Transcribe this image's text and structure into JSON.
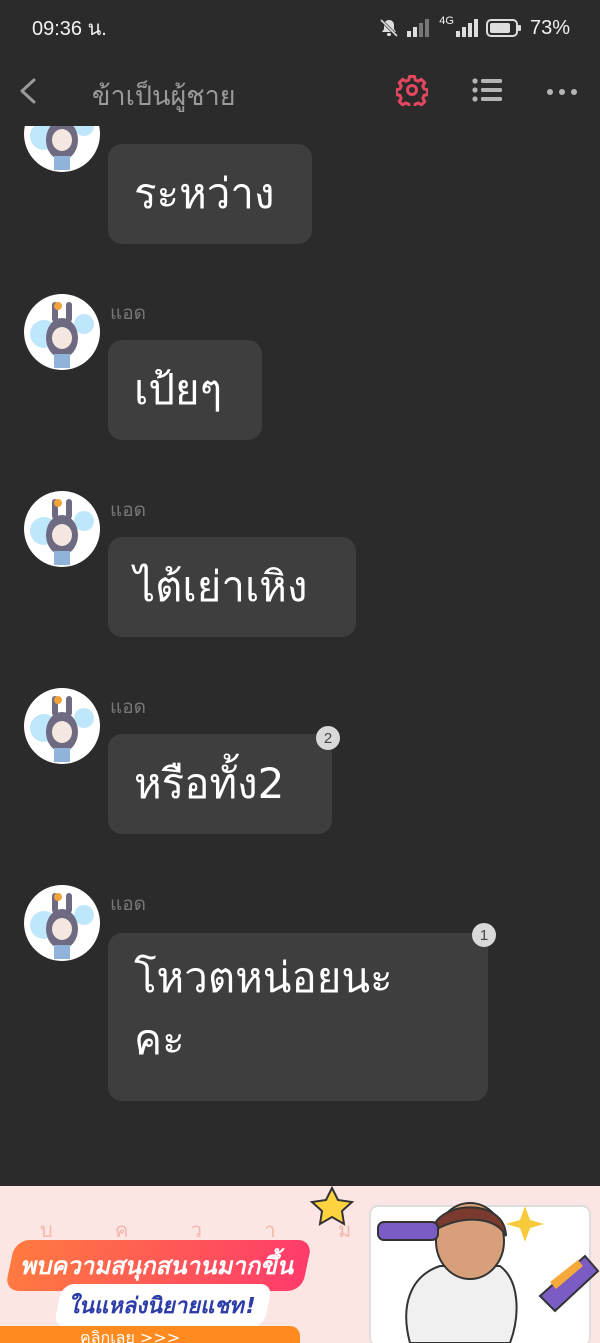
{
  "status_bar": {
    "time": "09:36 น.",
    "network": "4G",
    "battery": "73%"
  },
  "header": {
    "title": "ข้าเป็นผู้ชาย",
    "icons": [
      "back-arrow-icon",
      "gear-icon",
      "list-icon",
      "more-icon"
    ],
    "accent_color": "#e5475e"
  },
  "messages": [
    {
      "sender": "",
      "text_lines": [
        "ระหว่าง"
      ],
      "badge": ""
    },
    {
      "sender": "แอด",
      "text_lines": [
        "เป้ยๆ"
      ],
      "badge": ""
    },
    {
      "sender": "แอด",
      "text_lines": [
        "ไต้เย่าเหิง"
      ],
      "badge": ""
    },
    {
      "sender": "แอด",
      "text_lines": [
        "หรือทั้ง2"
      ],
      "badge": "2"
    },
    {
      "sender": "แอด",
      "text_lines": [
        "โหวตหน่อยนะ",
        "คะ"
      ],
      "badge": "1"
    }
  ],
  "banner": {
    "letters": "บ ค ว า ม ส น ุ ก   น   ม า ก ขึ้",
    "line1": "พบความสนุกสนานมากขึ้น",
    "line2": "ในแหล่งนิยายแชท!",
    "cta": "คลิกเลย >>>"
  }
}
